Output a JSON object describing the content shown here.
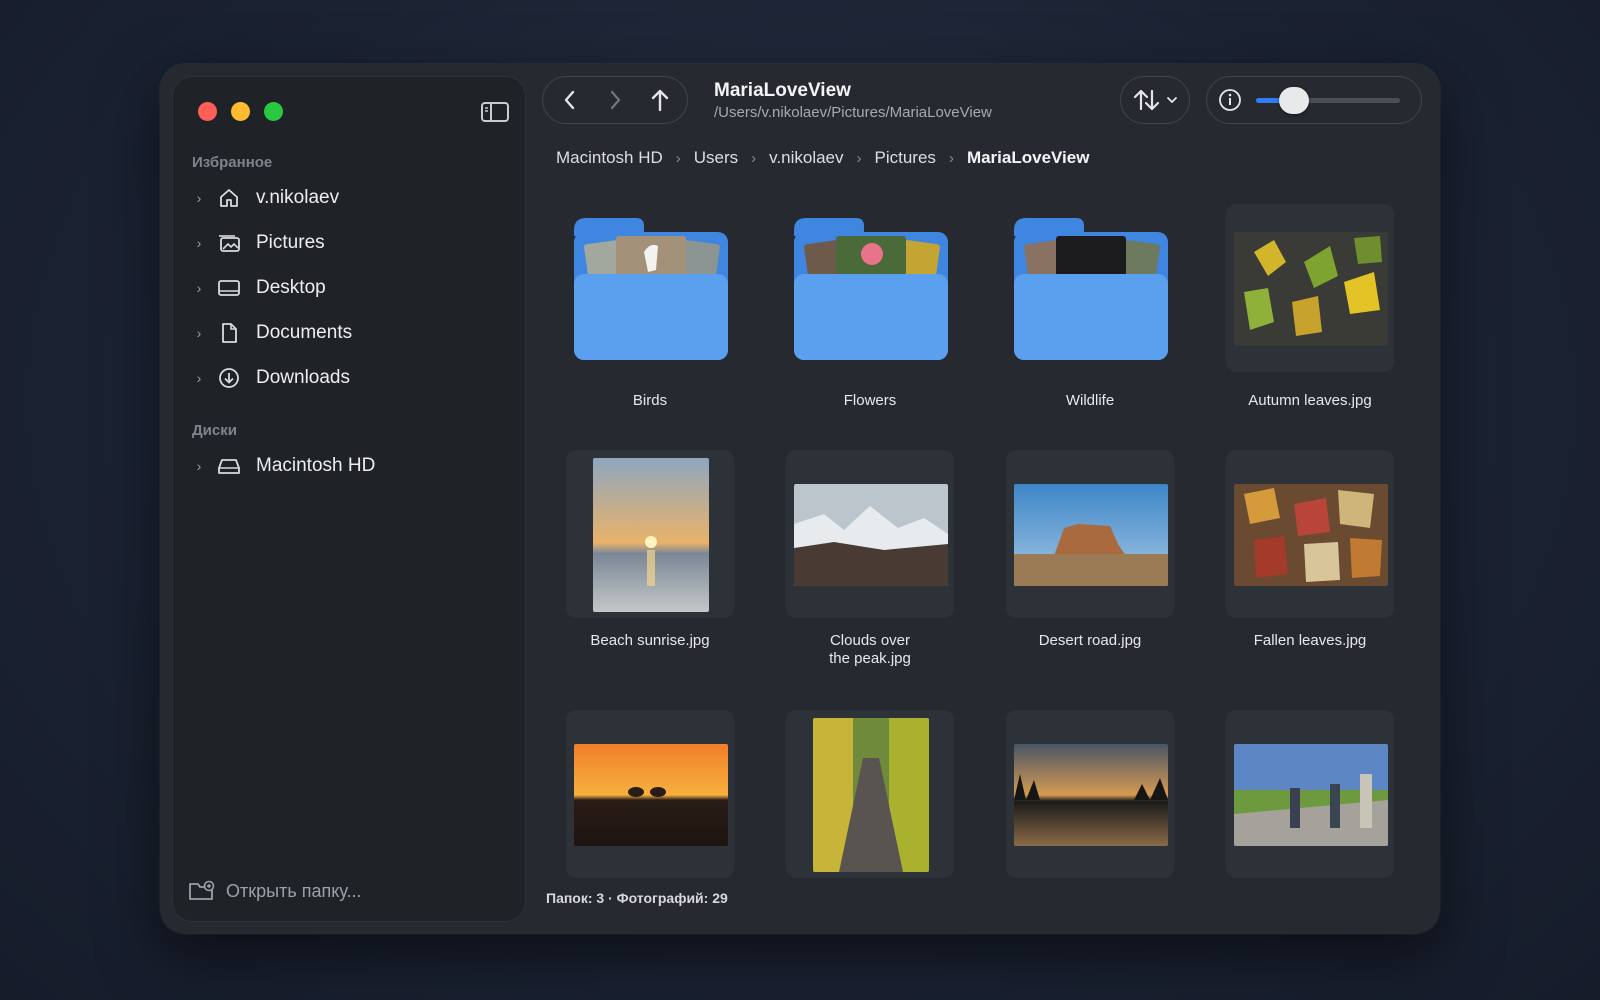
{
  "window": {
    "title": "MariaLoveView",
    "path": "/Users/v.nikolaev/Pictures/MariaLoveView"
  },
  "sidebar": {
    "favorites_title": "Избранное",
    "favorites": [
      {
        "label": "v.nikolaev",
        "icon": "home-icon"
      },
      {
        "label": "Pictures",
        "icon": "photos-icon"
      },
      {
        "label": "Desktop",
        "icon": "desktop-icon"
      },
      {
        "label": "Documents",
        "icon": "document-icon"
      },
      {
        "label": "Downloads",
        "icon": "download-icon"
      }
    ],
    "disks_title": "Диски",
    "disks": [
      {
        "label": "Macintosh HD",
        "icon": "drive-icon"
      }
    ],
    "open_folder_label": "Открыть папку..."
  },
  "toolbar": {
    "zoom_level": 0.2
  },
  "breadcrumb": [
    "Macintosh HD",
    "Users",
    "v.nikolaev",
    "Pictures",
    "MariaLoveView"
  ],
  "items": [
    {
      "name": "Birds",
      "kind": "folder"
    },
    {
      "name": "Flowers",
      "kind": "folder"
    },
    {
      "name": "Wildlife",
      "kind": "folder"
    },
    {
      "name": "Autumn leaves.jpg",
      "kind": "photo"
    },
    {
      "name": "Beach sunrise.jpg",
      "kind": "photo"
    },
    {
      "name_line1": "Clouds over",
      "name_line2": "the peak.jpg",
      "kind": "photo"
    },
    {
      "name": "Desert road.jpg",
      "kind": "photo"
    },
    {
      "name": "Fallen leaves.jpg",
      "kind": "photo"
    },
    {
      "name": "",
      "kind": "photo"
    },
    {
      "name": "",
      "kind": "photo"
    },
    {
      "name": "",
      "kind": "photo"
    },
    {
      "name": "",
      "kind": "photo"
    }
  ],
  "status": "Папок: 3 · Фотографий: 29",
  "colors": {
    "accent": "#2f7cf6",
    "folder_blue": "#5aa0ef",
    "close": "#ff5f57",
    "minimize": "#febc2e",
    "zoom": "#28c840"
  }
}
